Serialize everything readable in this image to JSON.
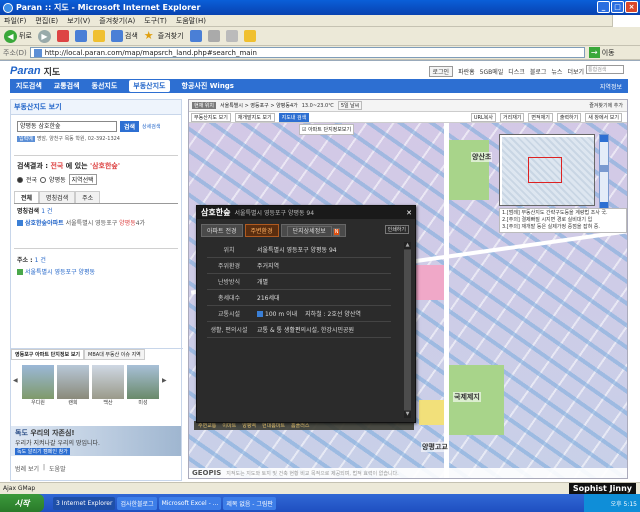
{
  "window": {
    "title": "Paran :: 지도 - Microsoft Internet Explorer"
  },
  "menu": [
    "파일(F)",
    "편집(E)",
    "보기(V)",
    "즐겨찾기(A)",
    "도구(T)",
    "도움말(H)"
  ],
  "toolbar": {
    "back": "뒤로",
    "search": "검색",
    "favorites": "즐겨찾기"
  },
  "address": {
    "label": "주소(D)",
    "url": "http://local.paran.com/map/mapsrch_land.php#search_main",
    "go": "이동"
  },
  "site": {
    "logo": "Paran",
    "logo_sub": "지도",
    "links": [
      "로그인",
      "파란홈",
      "5GB메일",
      "디스크",
      "블로그",
      "뉴스",
      "더보기"
    ],
    "search_placeholder": "통합검색",
    "nav": [
      "지도검색",
      "교통검색",
      "동선지도",
      "부동산지도",
      "항공사진 Wings"
    ],
    "nav_active": "부동산지도",
    "nav_right": "지역정보"
  },
  "left": {
    "title": "부동산지도 보기",
    "query": "양평동 삼호한숲",
    "search_btn": "검색",
    "detail_link": "상세검색",
    "example_tag": "입력예",
    "example": "명암, 양천구 목동 학원, 02-392-1324",
    "result_title_prefix": "검색결과 :",
    "result_region": "전국",
    "result_mid": "에 있는",
    "result_query": "'삼호한숲'",
    "radio_all": "전국",
    "radio_local": "양평동",
    "radio_btn": "지역선택",
    "tabs": [
      "전체",
      "명칭검색",
      "주소"
    ],
    "section1": "명칭검색",
    "section1_count": "1 건",
    "item1_name": "삼호한숲아파트",
    "item1_addr_pre": "서울특별시 영등포구",
    "item1_addr_hl": "양평동",
    "item1_addr_post": "4가",
    "section2": "주소 :",
    "section2_count": "1 건",
    "item2_addr": "서울특별시 영등포구 양평동",
    "complex_tabs": [
      "영등포구 아파트 단지정보 보기",
      "MBA대 부동산 이슈 지역"
    ],
    "thumbs": [
      "우디원",
      "랜희",
      "백산",
      "미성"
    ],
    "banner_title": "독도",
    "banner_line1": "우리의 자존심!",
    "banner_line2": "우리가 지켜나갈 우리의 땅입니다.",
    "banner_btn": "독도 알리기 캠페인 참가",
    "footer_links": [
      "범례 보기",
      "도움말"
    ]
  },
  "map": {
    "breadcrumb_badge": "현재 위치",
    "breadcrumb": "서울특별시 > 영등포구 > 양평동4가",
    "weather": "13.0~23.0℃",
    "weather_btn": "5일 날씨",
    "right_link": "즐겨찾기에 추가",
    "toolbar": [
      "부동산지도 보기",
      "재개발지도 보기",
      "지도내 검색"
    ],
    "toolbar_active": "지도내 검색",
    "toolbar_right": [
      "URL복사",
      "거리재기",
      "면적재기",
      "출력하기",
      "새 창에서 보기"
    ],
    "checkbox_label": "아파트 단지정보보기",
    "notes": [
      "1.[범례] 부동산지도 간략구도등을 계량법 조사 국.",
      "2.[주의] 결제빠질 시지면 경로 실비대기 입",
      "3.[주의] 재개발 등은 실제가정 중점을 잡혀 중."
    ],
    "labels": [
      "양산초",
      "국제제지",
      "양평고교"
    ],
    "legend_items": [
      "주변교통",
      "이마트",
      "양평역",
      "현대홈마트",
      "홈플러스"
    ],
    "footer_logo": "GEOPIS",
    "footer_text": "지적도는 지도와 토지 및 건축 현황 비교 목적으로 제공되며, 법적 효력이 없습니다."
  },
  "popup": {
    "name": "삼호한숲",
    "addr": "서울특별시 영등포구 양평동 94",
    "tabs": [
      "아파트 전경",
      "주변환경",
      "단지상세정보"
    ],
    "tab_active": "주변환경",
    "tab_new": "N",
    "print": "인쇄하기",
    "rows": [
      {
        "k": "위치",
        "v": "서울특별시 영등포구 양평동 94"
      },
      {
        "k": "주위환경",
        "v": "주거지역"
      },
      {
        "k": "난방방식",
        "v": "개별"
      },
      {
        "k": "총세대수",
        "v": "216세대"
      },
      {
        "k": "교통시설",
        "v": "100 m 이내",
        "v2": "지하철 : 2호선 양산역"
      },
      {
        "k": "생활, 편의시설",
        "v": "교통 & 통 생활편의시설, 한강시민공원"
      }
    ]
  },
  "status": {
    "text": "Ajax GMap",
    "signature": "Sophist Jinny"
  },
  "taskbar": {
    "start": "시작",
    "tasks": [
      "3 Internet Explorer",
      "검사한블로그",
      "Microsoft Excel - ...",
      "제목 없음 - 그림판"
    ],
    "clock": "오후 5:15"
  }
}
